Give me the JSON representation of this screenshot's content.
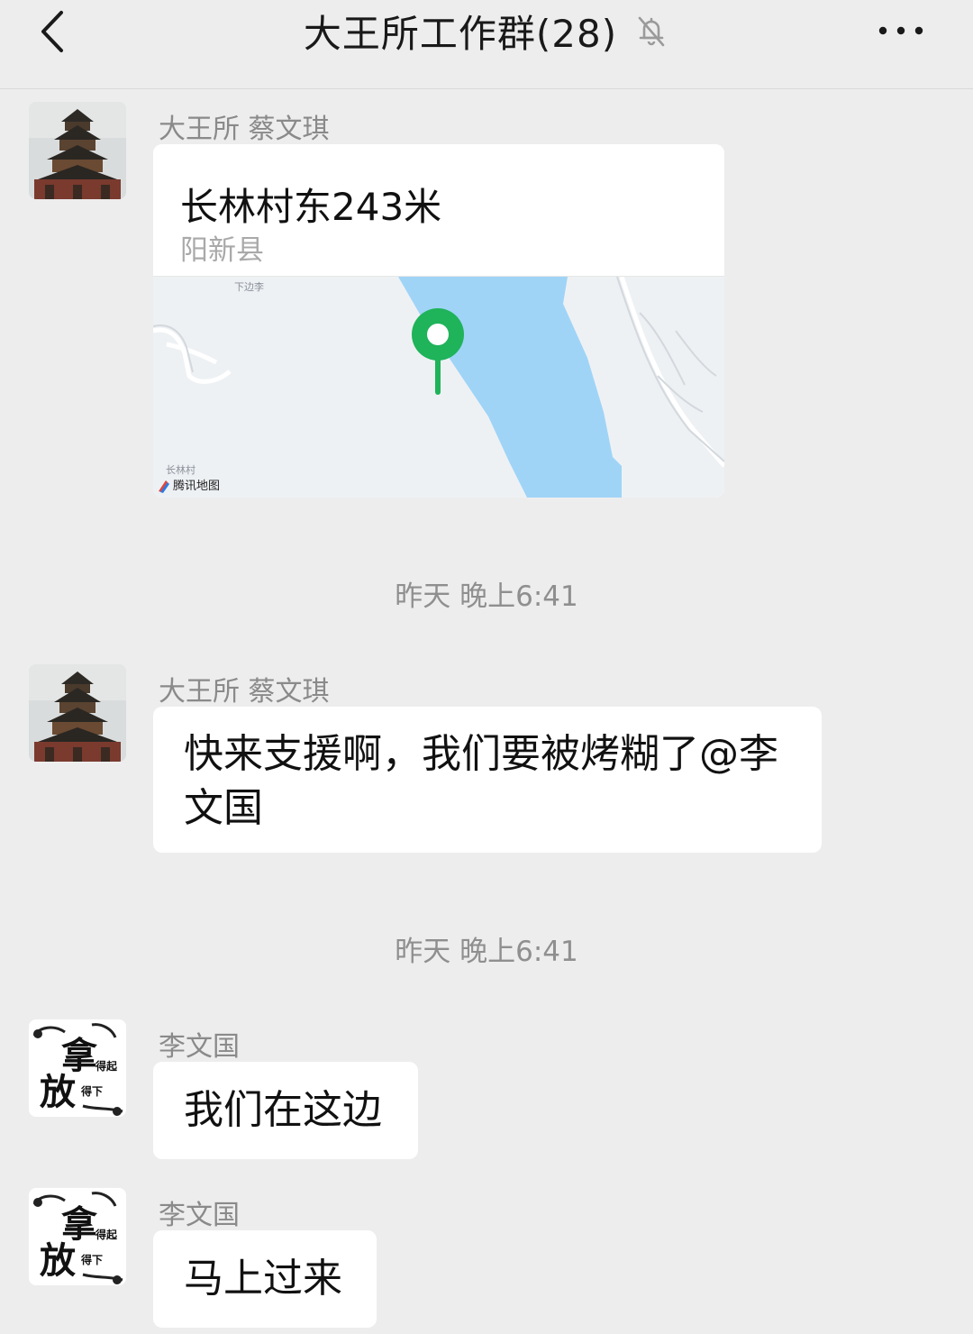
{
  "header": {
    "title": "大王所工作群(28)",
    "icons": [
      "back-chevron-icon",
      "mute-bell-icon",
      "more-dots-icon"
    ]
  },
  "messages": [
    {
      "sender": "大王所 蔡文琪",
      "avatar": "tower-photo-avatar",
      "type": "location",
      "location_name": "长林村东243米",
      "location_sub": "阳新县",
      "map_labels": {
        "top": "下边李",
        "bottom": "长林村",
        "attribution": "腾讯地图"
      }
    },
    {
      "type": "timestamp",
      "text": "昨天 晚上6:41"
    },
    {
      "sender": "大王所 蔡文琪",
      "avatar": "tower-photo-avatar",
      "type": "text",
      "lines": [
        "快来支援啊，我们要被烤糊了@李",
        "文国"
      ]
    },
    {
      "type": "timestamp",
      "text": "昨天 晚上6:41"
    },
    {
      "sender": "李文国",
      "avatar": "calligraphy-avatar",
      "type": "text",
      "lines": [
        "我们在这边"
      ]
    },
    {
      "sender": "李文国",
      "avatar": "calligraphy-avatar",
      "type": "text",
      "lines": [
        "马上过来"
      ]
    }
  ],
  "avatar_text": {
    "line1": "拿",
    "line1_small": "得起",
    "line2": "放",
    "line2_small": "得下"
  },
  "colors": {
    "background": "#ededed",
    "bubble": "#ffffff",
    "pin": "#1fb35a",
    "water": "#9fd4f7"
  }
}
